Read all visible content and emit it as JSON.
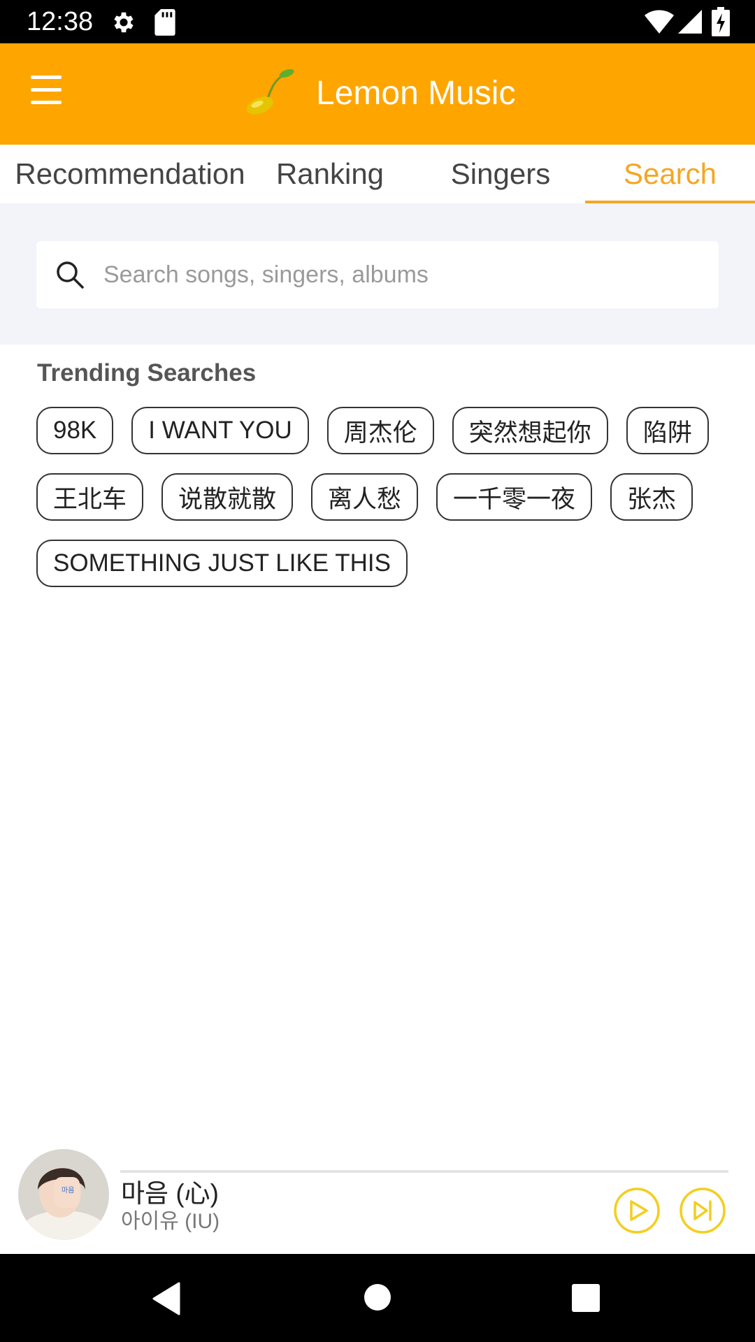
{
  "status_bar": {
    "time": "12:38"
  },
  "app_bar": {
    "title": "Lemon Music",
    "brand_color": "#ffa500"
  },
  "tabs": [
    {
      "label": "Recommendation",
      "active": false
    },
    {
      "label": "Ranking",
      "active": false
    },
    {
      "label": "Singers",
      "active": false
    },
    {
      "label": "Search",
      "active": true
    }
  ],
  "search": {
    "placeholder": "Search songs, singers, albums",
    "value": ""
  },
  "trending": {
    "title": "Trending Searches",
    "tags": [
      "98K",
      "I WANT YOU",
      "周杰伦",
      "突然想起你",
      "陷阱",
      "王北车",
      "说散就散",
      "离人愁",
      "一千零一夜",
      "张杰",
      "SOMETHING JUST LIKE THIS"
    ]
  },
  "player": {
    "song": "마음 (心)",
    "artist": "아이유 (IU)",
    "progress": 0,
    "accent_color": "#ffc40c"
  }
}
